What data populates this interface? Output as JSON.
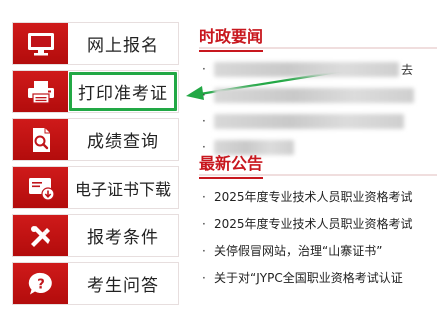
{
  "menu": {
    "items": [
      {
        "label": "网上报名",
        "icon": "monitor-icon"
      },
      {
        "label": "打印准考证",
        "icon": "printer-icon"
      },
      {
        "label": "成绩查询",
        "icon": "document-search-icon"
      },
      {
        "label": "电子证书下载",
        "icon": "certificate-download-icon"
      },
      {
        "label": "报考条件",
        "icon": "tools-icon"
      },
      {
        "label": "考生问答",
        "icon": "question-icon"
      }
    ]
  },
  "news": {
    "title": "时政要闻",
    "bullet": "·",
    "first_tail": "去"
  },
  "notices": {
    "title": "最新公告",
    "bullet": "·",
    "items": [
      {
        "text": "2025年度专业技术人员职业资格考试"
      },
      {
        "text": "2025年度专业技术人员职业资格考试"
      },
      {
        "text": "关停假冒网站，治理“山寨证书”"
      },
      {
        "text": "关于对“JYPC全国职业资格考试认证"
      }
    ]
  },
  "colors": {
    "accent_red": "#c8171e",
    "highlight_green": "#22a845"
  }
}
